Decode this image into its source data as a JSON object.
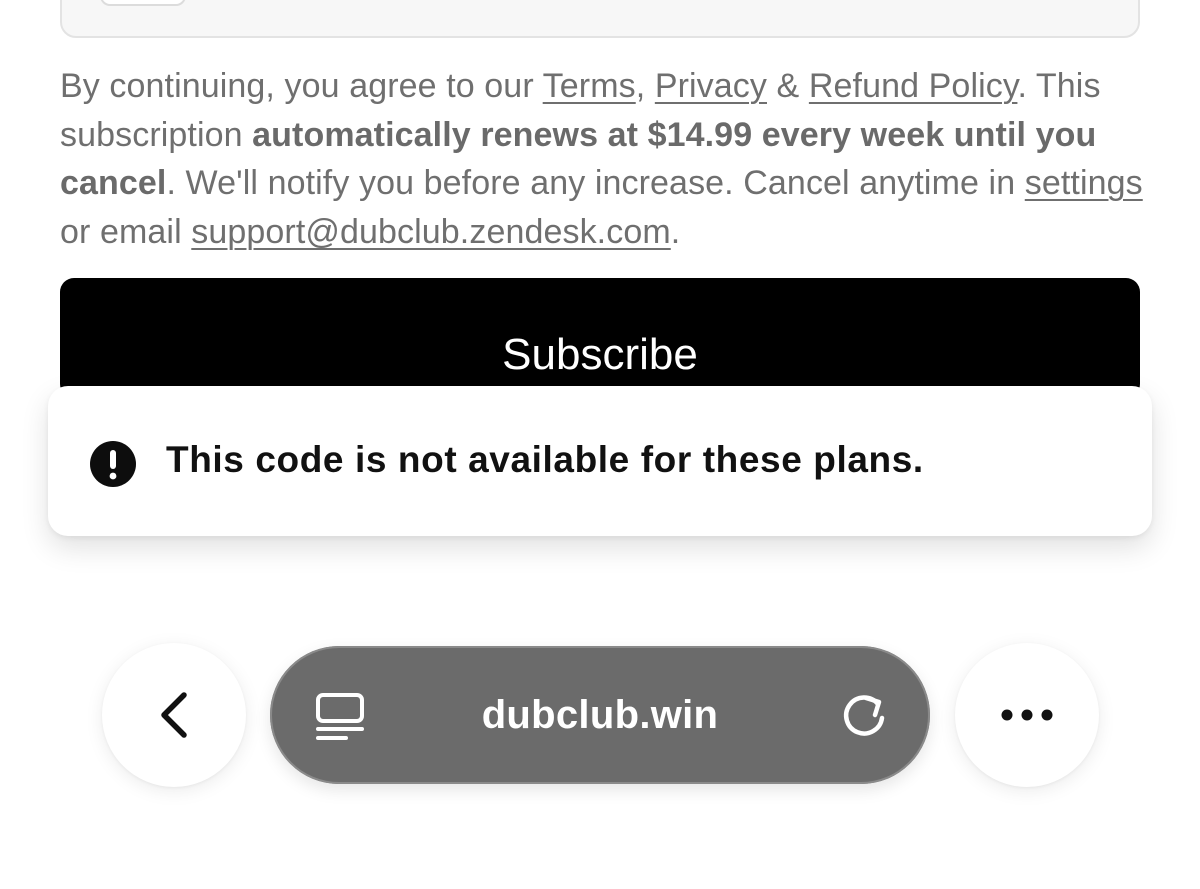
{
  "legal": {
    "prefix": "By continuing, you agree to our ",
    "terms_link": "Terms",
    "comma": ", ",
    "privacy_link": "Privacy",
    "amp": " & ",
    "refund_link": "Refund Policy",
    "period1": ".",
    "line2_prefix": " This subscription ",
    "renew_bold": "automatically renews at $14.99 every week until you cancel",
    "line2_suffix": ". We'll notify you before any increase. Cancel anytime in ",
    "settings_link": "settings",
    "or_email": " or email ",
    "support_email": "support@dubclub.zendesk.com",
    "period2": "."
  },
  "subscribe_button": {
    "label": "Subscribe"
  },
  "toast": {
    "icon": "exclamation-circle-icon",
    "message": "This code is not available for these plans."
  },
  "browser_bar": {
    "back_icon": "chevron-left-icon",
    "tab_icon": "tab-overview-icon",
    "url": "dubclub.win",
    "reload_icon": "reload-icon",
    "more_icon": "ellipsis-icon"
  },
  "colors": {
    "button_bg": "#000000",
    "url_pill_bg": "#6b6b6b",
    "legal_text": "#6f6f6f"
  }
}
